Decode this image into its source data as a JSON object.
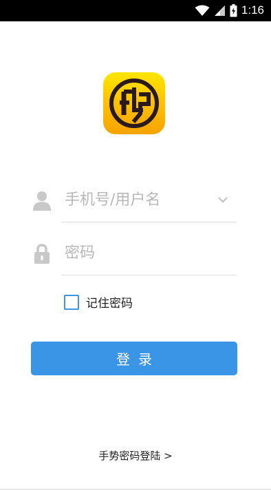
{
  "status_bar": {
    "time": "1:16"
  },
  "login": {
    "username_placeholder": "手机号/用户名",
    "password_placeholder": "密码",
    "remember_label": "记住密码",
    "remember_checked": false,
    "submit_label": "登录",
    "gesture_link": "手势密码登陆 >"
  },
  "icons": {
    "app_logo": "app-logo",
    "user": "user-icon",
    "lock": "lock-icon",
    "dropdown": "chevron-down-icon"
  },
  "colors": {
    "accent": "#3a95e6",
    "placeholder": "#b8b8b8",
    "icon": "#c8c8c8"
  }
}
